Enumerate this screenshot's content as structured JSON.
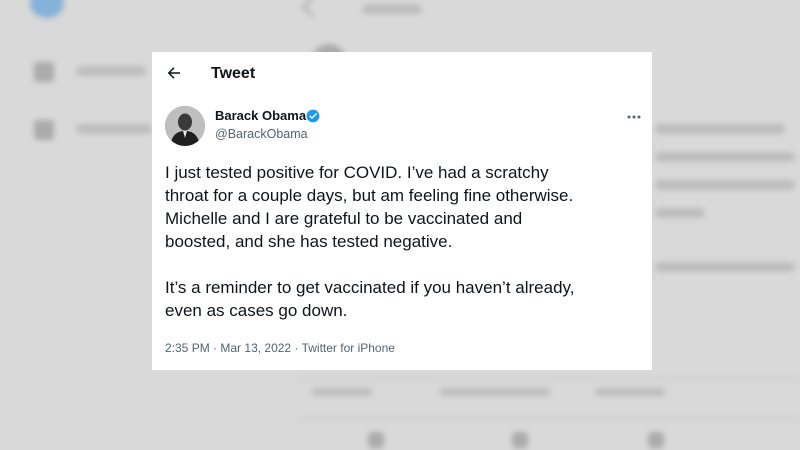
{
  "tweet_card": {
    "header_title": "Tweet",
    "author": {
      "name": "Barack Obama",
      "handle": "@BarackObama"
    },
    "text": {
      "paragraph1_lines": [
        "I just tested positive for COVID. I’ve had a scratchy",
        "throat for a couple days, but am feeling fine otherwise.",
        "Michelle and I are grateful to be vaccinated and",
        "boosted, and she has tested negative."
      ],
      "paragraph2_lines": [
        "It’s a reminder to get vaccinated if you haven’t already,",
        "even as cases go down."
      ]
    },
    "meta": {
      "time": "2:35 PM",
      "date": "Mar 13, 2022",
      "source": "Twitter for iPhone",
      "separator": "·"
    }
  },
  "icons": {
    "back": "arrow-left-icon",
    "verified": "verified-badge-icon",
    "more": "more-horizontal-icon"
  },
  "colors": {
    "verified_blue": "#1d9bf0",
    "text_primary": "#0f1419",
    "text_secondary": "#536471",
    "background": "#d9d9d9"
  }
}
